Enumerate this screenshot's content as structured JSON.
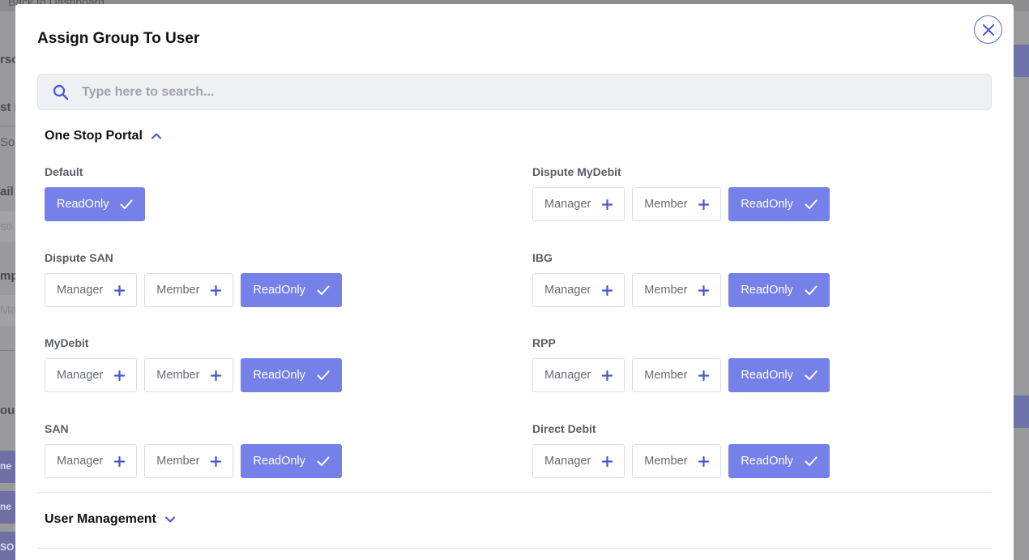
{
  "background": {
    "back_link": "Back to Dashboard",
    "fragments": [
      "rso",
      "st N",
      "So",
      "ail",
      "so",
      "mp",
      "Ma",
      "ou"
    ],
    "chips": [
      "ne",
      "ne",
      "SO"
    ]
  },
  "modal": {
    "title": "Assign Group To User",
    "search": {
      "placeholder": "Type here to search...",
      "value": ""
    }
  },
  "sections": {
    "one_stop_portal": {
      "label": "One Stop Portal",
      "expanded": true
    },
    "user_management": {
      "label": "User Management",
      "expanded": false
    }
  },
  "groups": {
    "default": {
      "label": "Default",
      "roles": [
        {
          "label": "ReadOnly",
          "selected": true
        }
      ]
    },
    "dispute_mydebit": {
      "label": "Dispute MyDebit",
      "roles": [
        {
          "label": "Manager",
          "selected": false
        },
        {
          "label": "Member",
          "selected": false
        },
        {
          "label": "ReadOnly",
          "selected": true
        }
      ]
    },
    "dispute_san": {
      "label": "Dispute SAN",
      "roles": [
        {
          "label": "Manager",
          "selected": false
        },
        {
          "label": "Member",
          "selected": false
        },
        {
          "label": "ReadOnly",
          "selected": true
        }
      ]
    },
    "ibg": {
      "label": "IBG",
      "roles": [
        {
          "label": "Manager",
          "selected": false
        },
        {
          "label": "Member",
          "selected": false
        },
        {
          "label": "ReadOnly",
          "selected": true
        }
      ]
    },
    "mydebit": {
      "label": "MyDebit",
      "roles": [
        {
          "label": "Manager",
          "selected": false
        },
        {
          "label": "Member",
          "selected": false
        },
        {
          "label": "ReadOnly",
          "selected": true
        }
      ]
    },
    "rpp": {
      "label": "RPP",
      "roles": [
        {
          "label": "Manager",
          "selected": false
        },
        {
          "label": "Member",
          "selected": false
        },
        {
          "label": "ReadOnly",
          "selected": true
        }
      ]
    },
    "san": {
      "label": "SAN",
      "roles": [
        {
          "label": "Manager",
          "selected": false
        },
        {
          "label": "Member",
          "selected": false
        },
        {
          "label": "ReadOnly",
          "selected": true
        }
      ]
    },
    "direct_debit": {
      "label": "Direct Debit",
      "roles": [
        {
          "label": "Manager",
          "selected": false
        },
        {
          "label": "Member",
          "selected": false
        },
        {
          "label": "ReadOnly",
          "selected": true
        }
      ]
    }
  },
  "colors": {
    "accent": "#7580e8",
    "accent_icon": "#4a55d4",
    "overlay": "#9a9a9c"
  },
  "icons": {
    "close": "close-icon",
    "search": "search-icon",
    "expand": "chevron-up-icon",
    "collapse": "chevron-down-icon",
    "add": "plus-icon",
    "selected": "check-icon"
  }
}
